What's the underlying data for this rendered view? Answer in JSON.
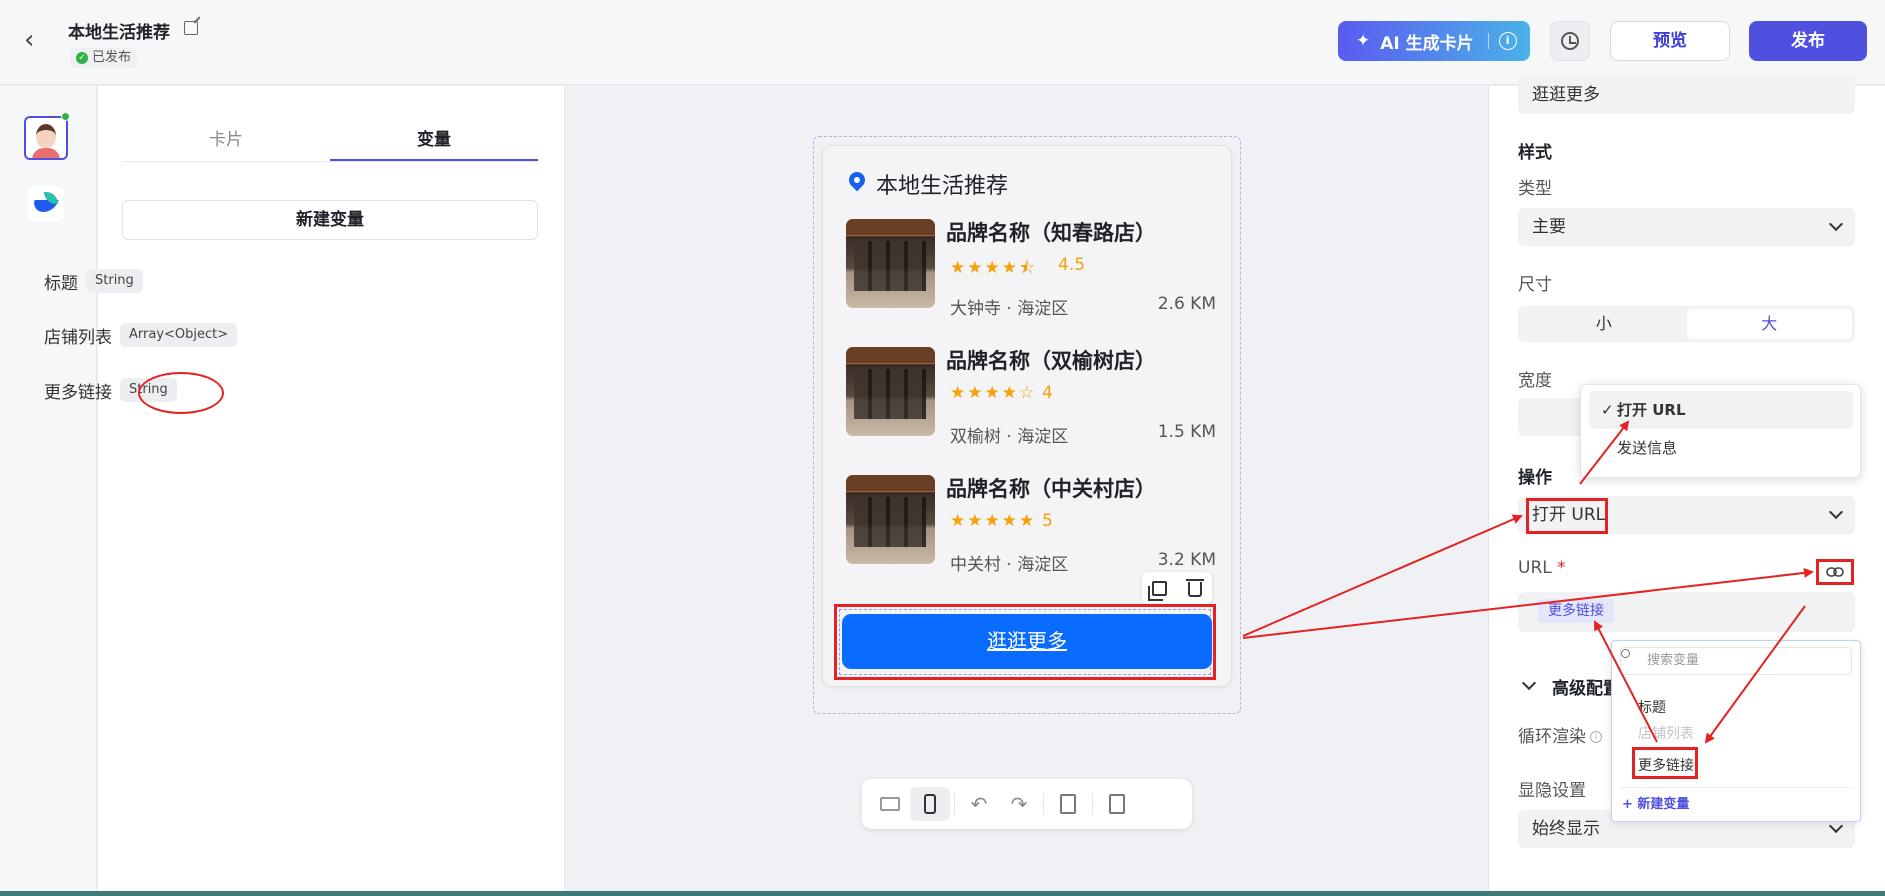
{
  "header": {
    "title": "本地生活推荐",
    "status": "已发布",
    "ai_button": "AI 生成卡片",
    "preview": "预览",
    "publish": "发布"
  },
  "sidebar": {
    "tabs": [
      {
        "label": "卡片"
      },
      {
        "label": "变量"
      }
    ],
    "active_tab": "变量",
    "new_variable": "新建变量",
    "variables": [
      {
        "name": "标题",
        "type": "String"
      },
      {
        "name": "店铺列表",
        "type": "Array<Object>"
      },
      {
        "name": "更多链接",
        "type": "String"
      }
    ]
  },
  "card": {
    "title": "本地生活推荐",
    "stores": [
      {
        "name": "品牌名称（知春路店）",
        "stars": "★★★★⯪",
        "rating": "4.5",
        "location": "大钟寺 · 海淀区",
        "distance": "2.6 KM"
      },
      {
        "name": "品牌名称（双榆树店）",
        "stars": "★★★★☆",
        "rating": "4",
        "location": "双榆树 · 海淀区",
        "distance": "1.5 KM"
      },
      {
        "name": "品牌名称（中关村店）",
        "stars": "★★★★★",
        "rating": "5",
        "location": "中关村 · 海淀区",
        "distance": "3.2 KM"
      }
    ],
    "more_button": "逛逛更多"
  },
  "toolbar": {
    "undo": "↶",
    "redo": "↷"
  },
  "props": {
    "top_field": "逛逛更多",
    "style_heading": "样式",
    "type_label": "类型",
    "type_value": "主要",
    "size_label": "尺寸",
    "size_small": "小",
    "size_large": "大",
    "width_label": "宽度",
    "action_heading": "操作",
    "action_value": "打开 URL",
    "url_label": "URL",
    "url_required": "*",
    "url_chip": "更多链接",
    "advanced": "高级配置",
    "loop_label": "循环渲染",
    "visibility_label": "显隐设置",
    "visibility_value": "始终显示"
  },
  "action_menu": {
    "items": [
      "打开 URL",
      "发送信息"
    ],
    "selected": "打开 URL",
    "check": "✓"
  },
  "var_menu": {
    "search_placeholder": "搜索变量",
    "items": [
      "标题",
      "店铺列表",
      "更多链接"
    ],
    "new_variable": "+ 新建变量"
  },
  "colors": {
    "accent": "#4f4fe0",
    "primary_button": "#0a6bff",
    "annotation_red": "#e52222",
    "star": "#f5a20a"
  }
}
